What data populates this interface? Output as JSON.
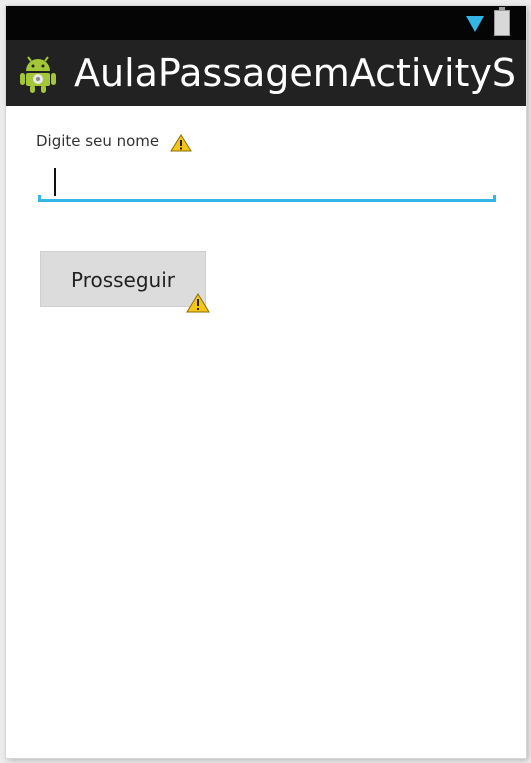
{
  "status_bar": {
    "wifi_icon": "wifi-icon",
    "battery_icon": "battery-icon",
    "accent_color": "#33b5e5"
  },
  "action_bar": {
    "app_icon": "android-icon",
    "title": "AulaPassagemActivityS"
  },
  "form": {
    "label": "Digite seu nome",
    "input_value": "",
    "button_label": "Prosseguir",
    "warning_icon": "warning-icon"
  }
}
